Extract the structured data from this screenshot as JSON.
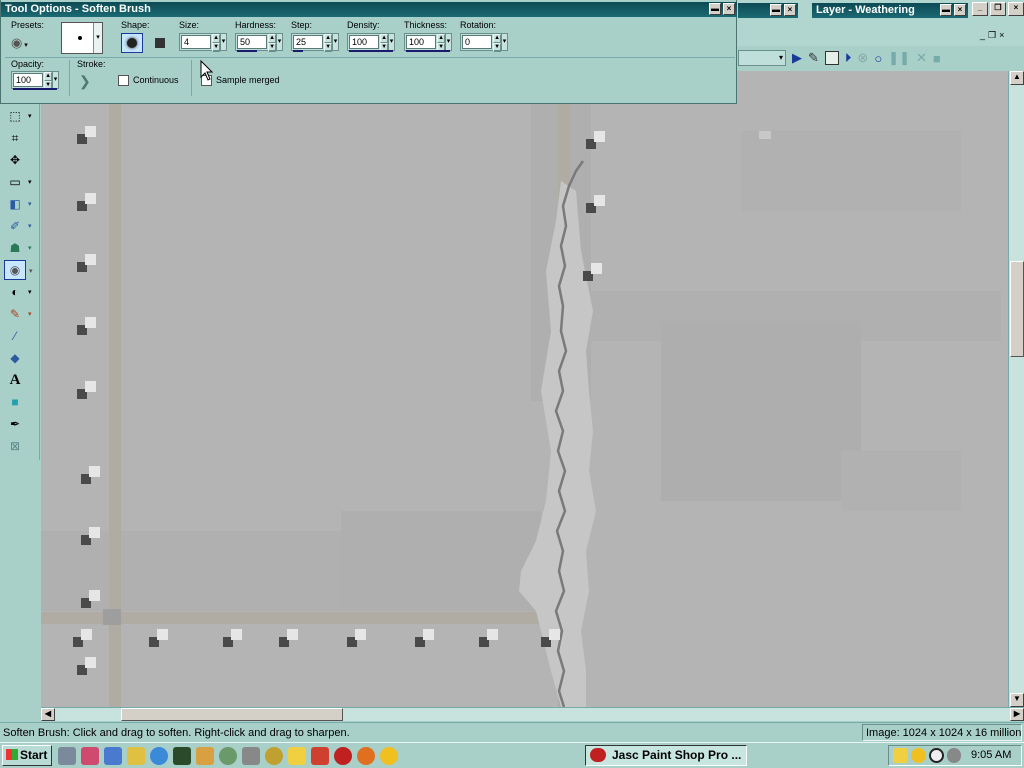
{
  "tool_options": {
    "title": "Tool Options - Soften Brush",
    "presets_label": "Presets:",
    "shape_label": "Shape:",
    "size_label": "Size:",
    "size_value": "4",
    "hardness_label": "Hardness:",
    "hardness_value": "50",
    "step_label": "Step:",
    "step_value": "25",
    "density_label": "Density:",
    "density_value": "100",
    "thickness_label": "Thickness:",
    "thickness_value": "100",
    "rotation_label": "Rotation:",
    "rotation_value": "0",
    "opacity_label": "Opacity:",
    "opacity_value": "100",
    "stroke_label": "Stroke:",
    "continuous_label": "Continuous",
    "sample_merged_label": "Sample merged"
  },
  "layer_palette": {
    "title": "Layer - Weathering"
  },
  "status_bar": {
    "hint": "Soften Brush: Click and drag to soften. Right-click and drag to sharpen.",
    "image_info": "Image:  1024 x 1024 x 16 million"
  },
  "taskbar": {
    "start_label": "Start",
    "app_task_label": "Jasc Paint Shop Pro ...",
    "clock": "9:05 AM"
  },
  "colors": {
    "teal_bg": "#a8cfc8",
    "title_bar": "#0c4a55",
    "canvas_gray": "#b4b4b4",
    "taskbar": "#a8cfc8"
  }
}
